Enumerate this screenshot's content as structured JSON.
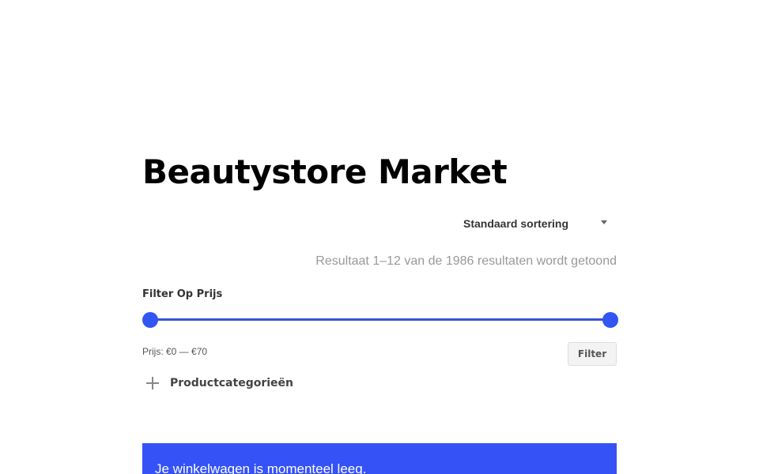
{
  "page": {
    "title": "Beautystore Market"
  },
  "sorting": {
    "selected": "Standaard sortering"
  },
  "results": {
    "count_text": "Resultaat 1–12 van de 1986 resultaten wordt getoond"
  },
  "price_filter": {
    "heading": "Filter Op Prijs",
    "price_text": "Prijs: €0 — €70",
    "min_value": 0,
    "max_value": 70,
    "button_label": "Filter",
    "accent_color": "#3156f3"
  },
  "categories": {
    "label": "Productcategorieën",
    "icon": "plus-icon"
  },
  "cart": {
    "notice": "Je winkelwagen is momenteel leeg.",
    "background_color": "#3452f6"
  }
}
